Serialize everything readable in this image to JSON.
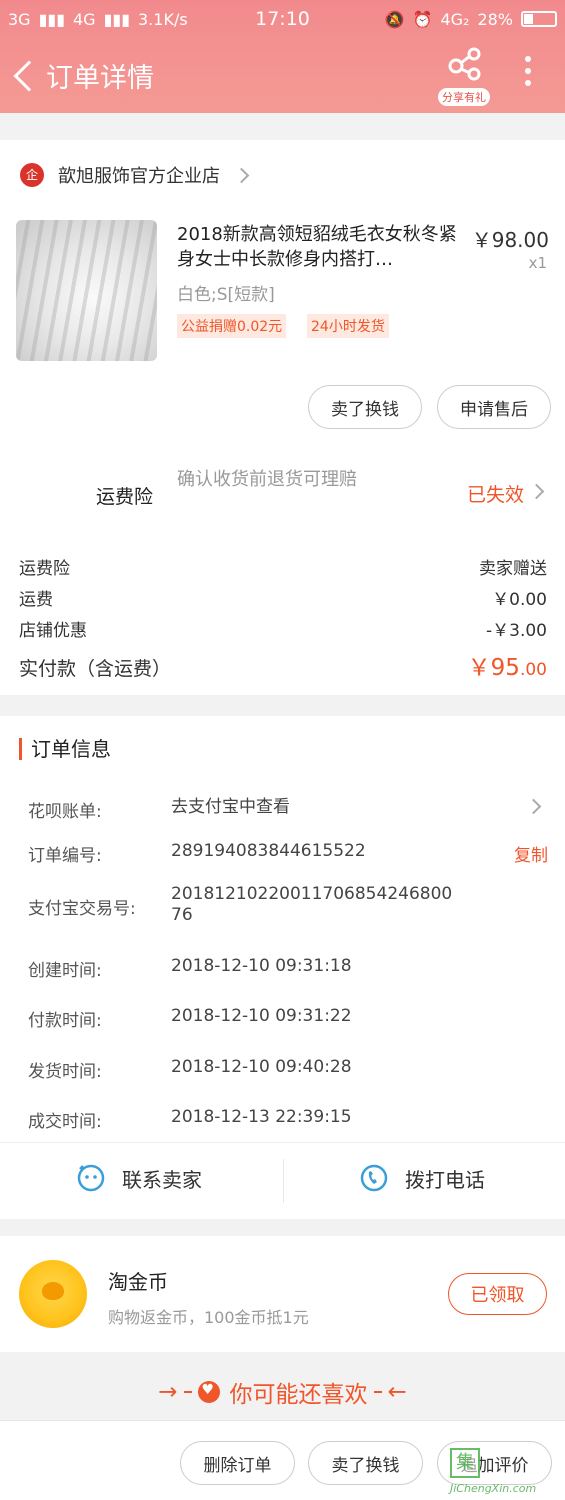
{
  "status_bar": {
    "signal_left": "3G",
    "signal_2": "4G",
    "speed": "3.1K/s",
    "time": "17:10",
    "network_right": "4G₂",
    "battery": "28%"
  },
  "nav": {
    "title": "订单详情",
    "share_label": "分享有礼"
  },
  "shop": {
    "logo_text": "企",
    "name": "歆旭服饰官方企业店"
  },
  "product": {
    "title": "2018新款高领短貂绒毛衣女秋冬紧身女士中长款修身内搭打…",
    "price": "￥98.00",
    "qty": "x1",
    "sku": "白色;S[短款]",
    "tag_charity": "公益捐赠0.02元",
    "tag_shipping": "24小时发货"
  },
  "actions": {
    "sell_exchange": "卖了换钱",
    "after_sale": "申请售后"
  },
  "insurance": {
    "label": "运费险",
    "desc": "确认收货前退货可理赔",
    "status": "已失效"
  },
  "fees": [
    {
      "label": "运费险",
      "value": "卖家赠送"
    },
    {
      "label": "运费",
      "value": "￥0.00"
    },
    {
      "label": "店铺优惠",
      "value": "-￥3.00"
    }
  ],
  "paid": {
    "label": "实付款（含运费）",
    "amount_main": "￥95",
    "amount_decimal": ".00"
  },
  "order_info": {
    "title": "订单信息",
    "huabei_label": "花呗账单:",
    "huabei_value": "去支付宝中查看",
    "order_no_label": "订单编号:",
    "order_no_value": "289194083844615522",
    "copy": "复制",
    "alipay_label": "支付宝交易号:",
    "alipay_value": "20181210220011706854246800 76",
    "created_label": "创建时间:",
    "created_value": "2018-12-10 09:31:18",
    "paid_label": "付款时间:",
    "paid_value": "2018-12-10 09:31:22",
    "shipped_label": "发货时间:",
    "shipped_value": "2018-12-10 09:40:28",
    "closed_label": "成交时间:",
    "closed_value": "2018-12-13 22:39:15"
  },
  "contact": {
    "seller": "联系卖家",
    "phone": "拨打电话"
  },
  "coins": {
    "title": "淘金币",
    "desc": "购物返金币，100金币抵1元",
    "button": "已领取"
  },
  "recommend": {
    "title": "你可能还喜欢"
  },
  "bottom": {
    "delete": "删除订单",
    "sell_exchange": "卖了换钱",
    "review": "追加评价"
  },
  "watermark": {
    "char": "集",
    "text": "JiChengXin.com"
  },
  "colors": {
    "accent": "#f0562a",
    "header": "#f28a8d",
    "icon_blue": "#3a9fd8"
  }
}
